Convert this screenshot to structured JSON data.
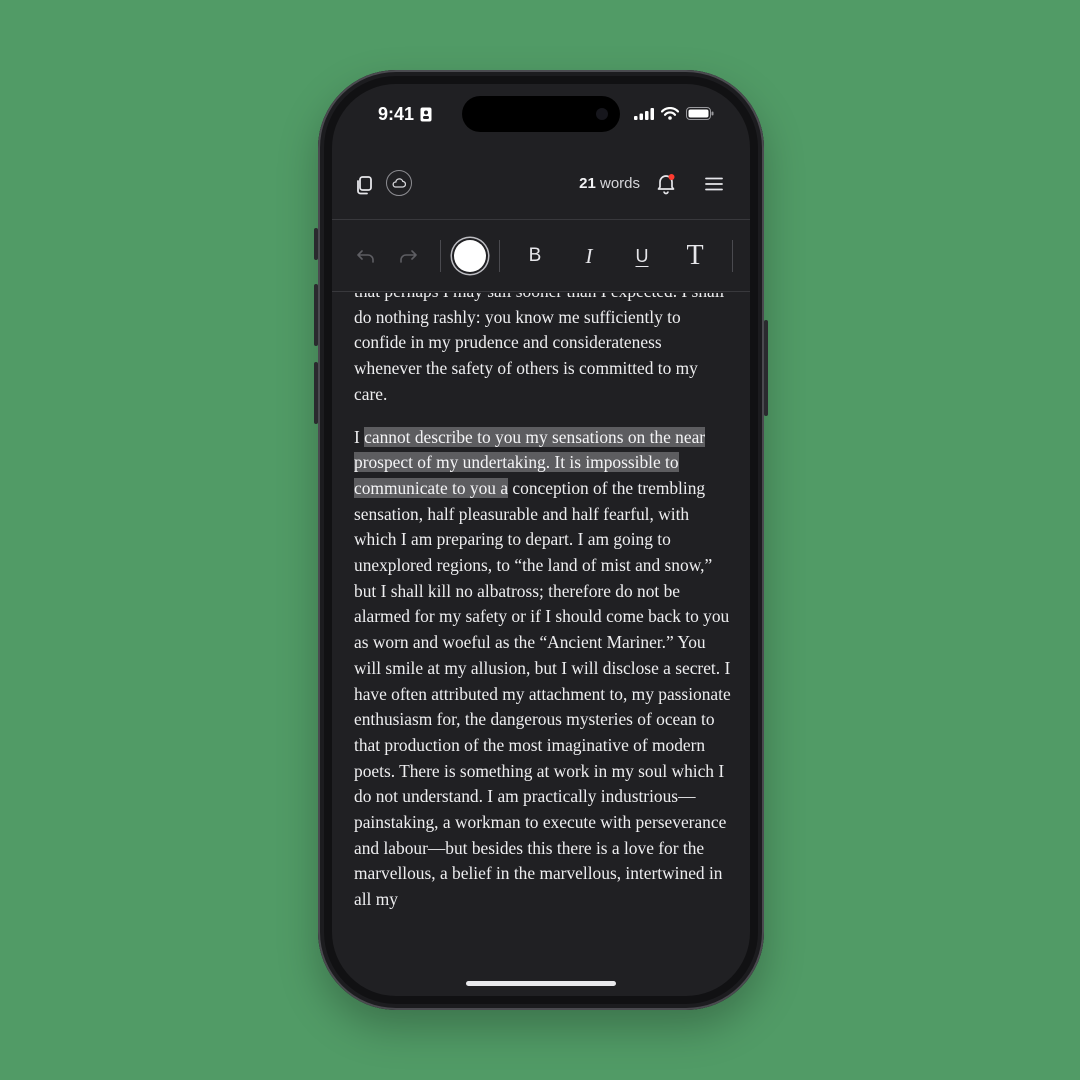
{
  "status_bar": {
    "time": "9:41"
  },
  "header": {
    "word_count_number": "21",
    "word_count_unit": "words",
    "icons": [
      "copy-icon",
      "cloud-icon",
      "bell-icon",
      "menu-icon"
    ],
    "notification_dot_color": "#ff3b30"
  },
  "toolbar": {
    "bold_label": "B",
    "italic_label": "I",
    "underline_label": "U",
    "text_style_label": "T",
    "selected_color": "#ffffff"
  },
  "document": {
    "paragraph_1": "that perhaps I may sail sooner than I expected. I shall do nothing rashly: you know me sufficiently to confide in my prudence and considerateness whenever the safety of others is committed to my care.",
    "paragraph_2_lead": "I ",
    "paragraph_2_selected": "cannot describe to you my sensations on the near prospect of my undertaking. It is impossible to communicate to you a",
    "paragraph_2_rest": " conception of the trembling sensation, half pleasurable and half fearful, with which I am preparing to depart. I am going to unexplored regions, to “the land of mist and snow,” but I shall kill no albatross; therefore do not be alarmed for my safety or if I should come back to you as worn and woeful as the “Ancient Mariner.” You will smile at my allusion, but I will disclose a secret. I have often attributed my attachment to, my passionate enthusiasm for, the dangerous mysteries of ocean to that production of the most imaginative of modern poets. There is something at work in my soul which I do not understand. I am practically industrious—painstaking, a workman to execute with perseverance and labour—but besides this there is a love for the marvellous, a belief in the marvellous, intertwined in all my"
  },
  "colors": {
    "background": "#519b66",
    "screen": "#202023",
    "selection": "#5d5d60"
  }
}
